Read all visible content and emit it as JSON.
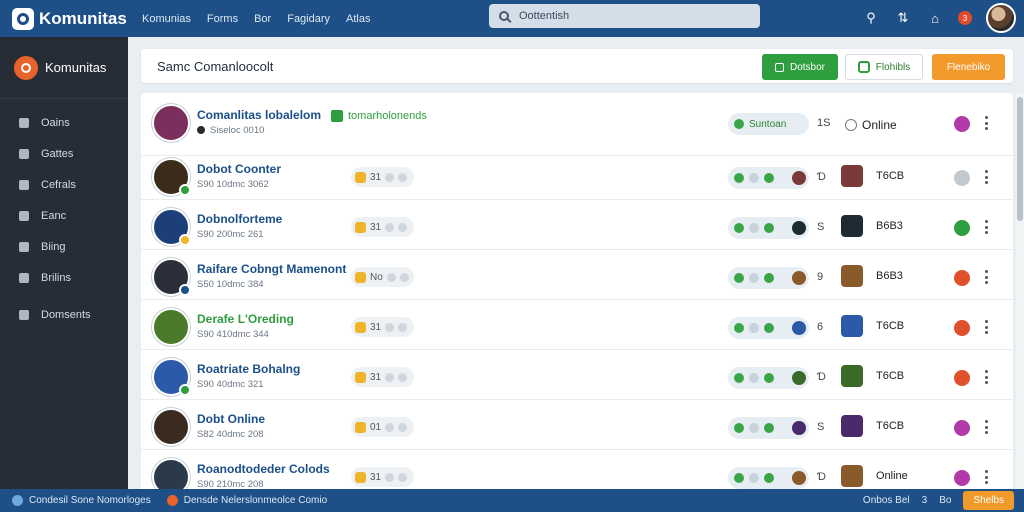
{
  "topbar": {
    "brand": "Komunitas",
    "nav": [
      "Komunias",
      "Forms",
      "Bor",
      "Fagidary",
      "Atlas"
    ],
    "search_placeholder": "Oottentish",
    "notification_count": "3"
  },
  "sidebar": {
    "brand": "Komunitas",
    "items": [
      {
        "label": "Oains",
        "icon": "user-icon"
      },
      {
        "label": "Gattes",
        "icon": "puzzle-icon"
      },
      {
        "label": "Cefrals",
        "icon": "chat-icon"
      },
      {
        "label": "Eanc",
        "icon": "pen-icon"
      },
      {
        "label": "Biing",
        "icon": "person-icon"
      },
      {
        "label": "Brilins",
        "icon": "grid-icon"
      },
      {
        "label": "Domsents",
        "icon": "document-icon"
      }
    ]
  },
  "toolbar": {
    "title": "Samc  Comanloocolt",
    "green_button": "Dotsbor",
    "outline_button": "Flohibls",
    "orange_button": "Flenebiko"
  },
  "rows": [
    {
      "name": "Comanlitas lobalelom",
      "sub": "Siseloc 0010",
      "verified": "tomarholonends",
      "status": "Suntoan",
      "count": "1S",
      "online": "Online",
      "circle_color": "#b23aa8",
      "avatar_color": "#7a2f5c"
    },
    {
      "name": "Dobot Coonter",
      "sub": "S90 10dmc 3062",
      "tag": "31",
      "count": "Ɗ",
      "code": "T6CB",
      "circle_color": "#c4c9ce",
      "avatar_color": "#3b2b1a",
      "badge": "#2e9e3f",
      "thumb": "#7a3a3a"
    },
    {
      "name": "Dobnolforteme",
      "sub": "S90 200mc 261",
      "tag": "31",
      "count": "S",
      "code": "B6B3",
      "circle_color": "#2e9e3f",
      "avatar_color": "#1c3f7a",
      "badge": "#f0b429",
      "thumb": "#1f2b33"
    },
    {
      "name": "Raifare Cobngt Mamenont",
      "sub": "S50 10dmc 384",
      "tag": "No",
      "count": "9",
      "code": "B6B3",
      "circle_color": "#e0502a",
      "avatar_color": "#2a2f3a",
      "badge": "#1b4f8a",
      "thumb": "#8a5a2a"
    },
    {
      "name": "Derafe L'Oreding",
      "sub": "S90 410dmc 344",
      "tag": "31",
      "count": "6",
      "code": "T6CB",
      "circle_color": "#e0502a",
      "avatar_color": "#4a7a2a",
      "badge": "",
      "thumb": "#2a5aa8",
      "green_name": true
    },
    {
      "name": "Roatriate Bohalng",
      "sub": "S90 40dmc 321",
      "tag": "31",
      "count": "Ɗ",
      "code": "T6CB",
      "circle_color": "#e0502a",
      "avatar_color": "#2a5aa8",
      "badge": "#2e9e3f",
      "thumb": "#3a6a2a"
    },
    {
      "name": "Dobt Online",
      "sub": "S82 40dmc 208",
      "tag": "01",
      "count": "S",
      "code": "T6CB",
      "circle_color": "#b23aa8",
      "avatar_color": "#3a2a20",
      "badge": "",
      "thumb": "#4a2a6a"
    },
    {
      "name": "Roanodtodeder Colods",
      "sub": "S90 210mc 208",
      "tag": "31",
      "count": "Ɗ",
      "code": "Online",
      "circle_color": "#b23aa8",
      "avatar_color": "#2a3a4a",
      "badge": "",
      "thumb": "#8a5a2a"
    }
  ],
  "bottombar": {
    "left1": "Condesil Sone  Nomorloges",
    "left2": "Densde Nelerslonmeolce  Comio",
    "right1": "Onbos Bel",
    "right2": "3",
    "right3": "Bo",
    "button": "Shelbs"
  },
  "colors": {
    "primary": "#1e4f86",
    "sidebar": "#262d36",
    "green": "#2e9e3f",
    "orange": "#f39a2c"
  }
}
